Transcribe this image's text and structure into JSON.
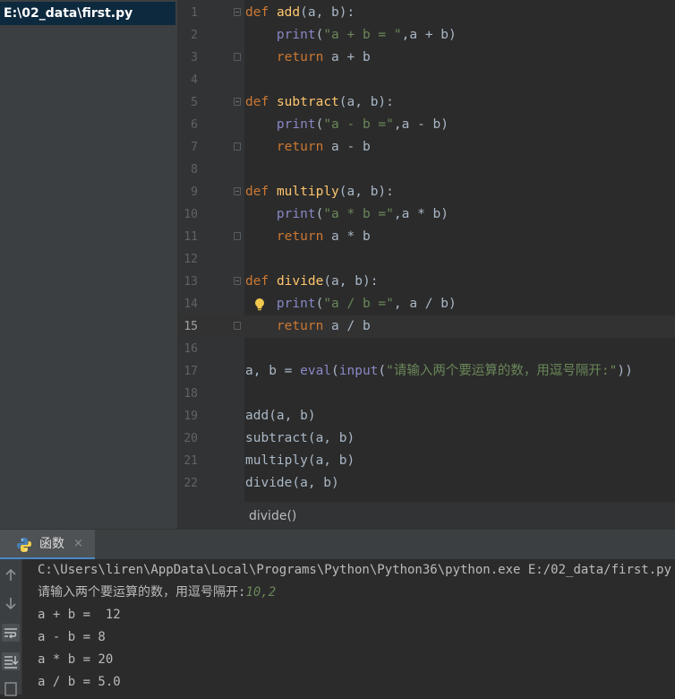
{
  "project": {
    "file_path": "E:\\02_data\\first.py"
  },
  "editor": {
    "current_line": 15,
    "lines": [
      {
        "n": "1",
        "tokens": [
          [
            "kw",
            "def"
          ],
          [
            "",
            " "
          ],
          [
            "fn",
            "add"
          ],
          [
            "",
            "(a, b):"
          ]
        ]
      },
      {
        "n": "2",
        "tokens": [
          [
            "",
            "    "
          ],
          [
            "bi",
            "print"
          ],
          [
            "",
            "("
          ],
          [
            "str",
            "\"a + b = \""
          ],
          [
            "",
            ",a + b)"
          ]
        ]
      },
      {
        "n": "3",
        "tokens": [
          [
            "",
            "    "
          ],
          [
            "kw",
            "return"
          ],
          [
            "",
            " a + b"
          ]
        ]
      },
      {
        "n": "4",
        "tokens": []
      },
      {
        "n": "5",
        "tokens": [
          [
            "kw",
            "def"
          ],
          [
            "",
            " "
          ],
          [
            "fn",
            "subtract"
          ],
          [
            "",
            "(a, b):"
          ]
        ]
      },
      {
        "n": "6",
        "tokens": [
          [
            "",
            "    "
          ],
          [
            "bi",
            "print"
          ],
          [
            "",
            "("
          ],
          [
            "str",
            "\"a - b =\""
          ],
          [
            "",
            ",a - b)"
          ]
        ]
      },
      {
        "n": "7",
        "tokens": [
          [
            "",
            "    "
          ],
          [
            "kw",
            "return"
          ],
          [
            "",
            " a - b"
          ]
        ]
      },
      {
        "n": "8",
        "tokens": []
      },
      {
        "n": "9",
        "tokens": [
          [
            "kw",
            "def"
          ],
          [
            "",
            " "
          ],
          [
            "fn",
            "multiply"
          ],
          [
            "",
            "(a, b):"
          ]
        ]
      },
      {
        "n": "10",
        "tokens": [
          [
            "",
            "    "
          ],
          [
            "bi",
            "print"
          ],
          [
            "",
            "("
          ],
          [
            "str",
            "\"a * b =\""
          ],
          [
            "",
            ",a * b)"
          ]
        ]
      },
      {
        "n": "11",
        "tokens": [
          [
            "",
            "    "
          ],
          [
            "kw",
            "return"
          ],
          [
            "",
            " a * b"
          ]
        ]
      },
      {
        "n": "12",
        "tokens": []
      },
      {
        "n": "13",
        "tokens": [
          [
            "kw",
            "def"
          ],
          [
            "",
            " "
          ],
          [
            "fn",
            "divide"
          ],
          [
            "",
            "(a, b):"
          ]
        ]
      },
      {
        "n": "14",
        "tokens": [
          [
            "",
            "    "
          ],
          [
            "bi",
            "print"
          ],
          [
            "",
            "("
          ],
          [
            "str",
            "\"a / b =\""
          ],
          [
            "",
            ", a / b)"
          ]
        ]
      },
      {
        "n": "15",
        "tokens": [
          [
            "",
            "    "
          ],
          [
            "kw",
            "return"
          ],
          [
            "",
            " a / b"
          ]
        ]
      },
      {
        "n": "16",
        "tokens": []
      },
      {
        "n": "17",
        "tokens": [
          [
            "",
            "a, b = "
          ],
          [
            "bi",
            "eval"
          ],
          [
            "",
            "("
          ],
          [
            "bi",
            "input"
          ],
          [
            "",
            "("
          ],
          [
            "str",
            "\"请输入两个要运算的数，用逗号隔开:\""
          ],
          [
            "",
            "))"
          ]
        ]
      },
      {
        "n": "18",
        "tokens": []
      },
      {
        "n": "19",
        "tokens": [
          [
            "",
            "add(a, b)"
          ]
        ]
      },
      {
        "n": "20",
        "tokens": [
          [
            "",
            "subtract(a, b)"
          ]
        ]
      },
      {
        "n": "21",
        "tokens": [
          [
            "",
            "multiply(a, b)"
          ]
        ]
      },
      {
        "n": "22",
        "tokens": [
          [
            "",
            "divide(a, b)"
          ]
        ]
      }
    ]
  },
  "breadcrumb": {
    "text": "divide()"
  },
  "run_panel": {
    "tab_label": "函数",
    "close_glyph": "×",
    "console": {
      "command": "C:\\Users\\liren\\AppData\\Local\\Programs\\Python\\Python36\\python.exe E:/02_data/first.py",
      "prompt": "请输入两个要运算的数，用逗号隔开:",
      "user_input": "10,2",
      "outputs": [
        "a + b =  12",
        "a - b = 8",
        "a * b = 20",
        "a / b = 5.0"
      ]
    },
    "toolbar_icons": [
      "arrow-up-icon",
      "arrow-down-icon",
      "soft-wrap-icon",
      "scroll-to-end-icon",
      "print-icon"
    ]
  },
  "colors": {
    "editor_bg": "#2b2b2b",
    "gutter_bg": "#313335",
    "panel_bg": "#3c3f41",
    "selection": "#0d293e",
    "keyword": "#cc7832",
    "function": "#ffc66d",
    "builtin": "#8888c6",
    "string": "#6a8759",
    "accent": "#4a88c7"
  }
}
